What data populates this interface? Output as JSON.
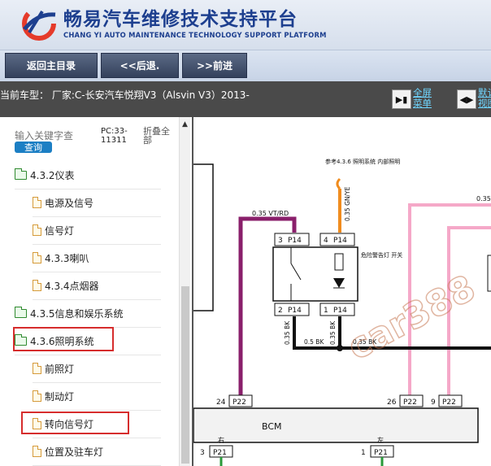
{
  "header": {
    "title": "畅易汽车维修技术支持平台",
    "subtitle": "CHANG YI AUTO MAINTENANCE TECHNOLOGY SUPPORT PLATFORM"
  },
  "toolbar": {
    "home_label": "返回主目录",
    "back_label": "<<后退.",
    "forward_label": ">>前进"
  },
  "vehicle": {
    "text": "当前车型： 厂家:C-长安汽车悦翔V3（Alsvin V3）2013-",
    "fullscreen_label": "全屏菜单",
    "next_label": "默认视图"
  },
  "sidebar": {
    "search_placeholder": "输入关键字查",
    "search_button": "查询",
    "pc_code": "PC:33-11311",
    "collapse_all": "折叠全部",
    "items": [
      {
        "label": "4.3.2仪表",
        "type": "folder",
        "indent": 0
      },
      {
        "label": "电源及信号",
        "type": "doc",
        "indent": 1
      },
      {
        "label": "信号灯",
        "type": "doc",
        "indent": 1
      },
      {
        "label": "4.3.3喇叭",
        "type": "doc",
        "indent": 1
      },
      {
        "label": "4.3.4点烟器",
        "type": "doc",
        "indent": 1
      },
      {
        "label": "4.3.5信息和娱乐系统",
        "type": "folder",
        "indent": 0
      },
      {
        "label": "4.3.6照明系统",
        "type": "folder",
        "indent": 0
      },
      {
        "label": "前照灯",
        "type": "doc",
        "indent": 1
      },
      {
        "label": "制动灯",
        "type": "doc",
        "indent": 1
      },
      {
        "label": "转向信号灯",
        "type": "doc",
        "indent": 1
      },
      {
        "label": "位置及驻车灯",
        "type": "doc",
        "indent": 1
      }
    ]
  },
  "diagram": {
    "ref_note": "参考4.3.6 照明系统 内部照明",
    "wire_vt_rd": "0.35 VT/RD",
    "wire_gn_ye": "0.35 GN/YE",
    "wire_bk_1": "0.35 BK",
    "wire_bk_2": "0.35 BK",
    "wire_bk_3": "0.5 BK",
    "wire_bk_4": "0.35 BK",
    "wire_035": "0.35",
    "switch_label": "危险警告灯 开关",
    "pins": {
      "p14_3": "3",
      "p14_4": "4",
      "p14_2": "2",
      "p14_1": "1",
      "p14_name": "P14",
      "p22_24": "24",
      "p22_26": "26",
      "p22_9": "9",
      "p22_name": "P22",
      "p21_3": "3",
      "p21_1": "1",
      "p21_name": "P21"
    },
    "bcm_label": "BCM",
    "right_label": "右",
    "left_label": "左",
    "watermark": "car388",
    "colors": {
      "violet_red": "#8a1f6b",
      "orange": "#f08c1e",
      "pink": "#f5a8c8",
      "black": "#111111"
    }
  }
}
